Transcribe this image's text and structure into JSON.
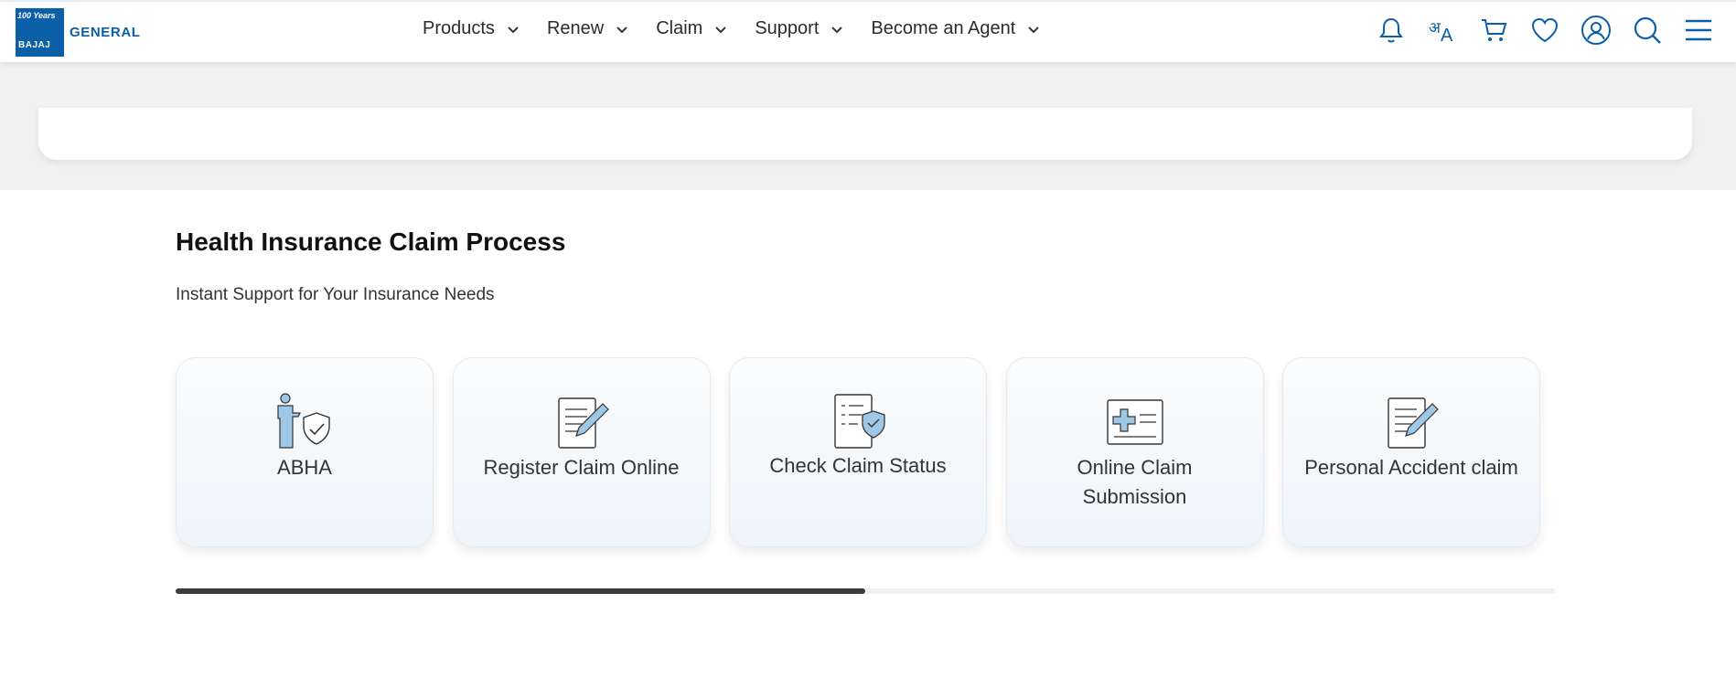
{
  "header": {
    "logo": {
      "years": "100 Years",
      "brand": "BAJAJ",
      "name": "GENERAL"
    },
    "nav": [
      {
        "label": "Products"
      },
      {
        "label": "Renew"
      },
      {
        "label": "Claim"
      },
      {
        "label": "Support"
      },
      {
        "label": "Become an Agent"
      }
    ],
    "language_icon": {
      "hi": "अ",
      "en": "A"
    },
    "icons": [
      "bell-icon",
      "language-icon",
      "cart-icon",
      "heart-icon",
      "user-icon",
      "search-icon",
      "menu-icon"
    ]
  },
  "section": {
    "title": "Health Insurance Claim Process",
    "subtitle": "Instant Support for Your Insurance Needs",
    "cards": [
      {
        "label": "ABHA",
        "icon": "abha-shield-person-icon"
      },
      {
        "label": "Register Claim Online",
        "icon": "document-pen-icon"
      },
      {
        "label": "Check Claim Status",
        "icon": "document-shield-icon"
      },
      {
        "label": "Online Claim Submission",
        "icon": "medical-card-icon"
      },
      {
        "label": "Personal Accident claim",
        "icon": "document-pen-icon"
      }
    ]
  },
  "carousel": {
    "scroll_progress": 0.5
  },
  "colors": {
    "brand": "#0b5fa8",
    "icon_accent": "#9ec8e6",
    "scroll_thumb": "#3a3a3a"
  }
}
